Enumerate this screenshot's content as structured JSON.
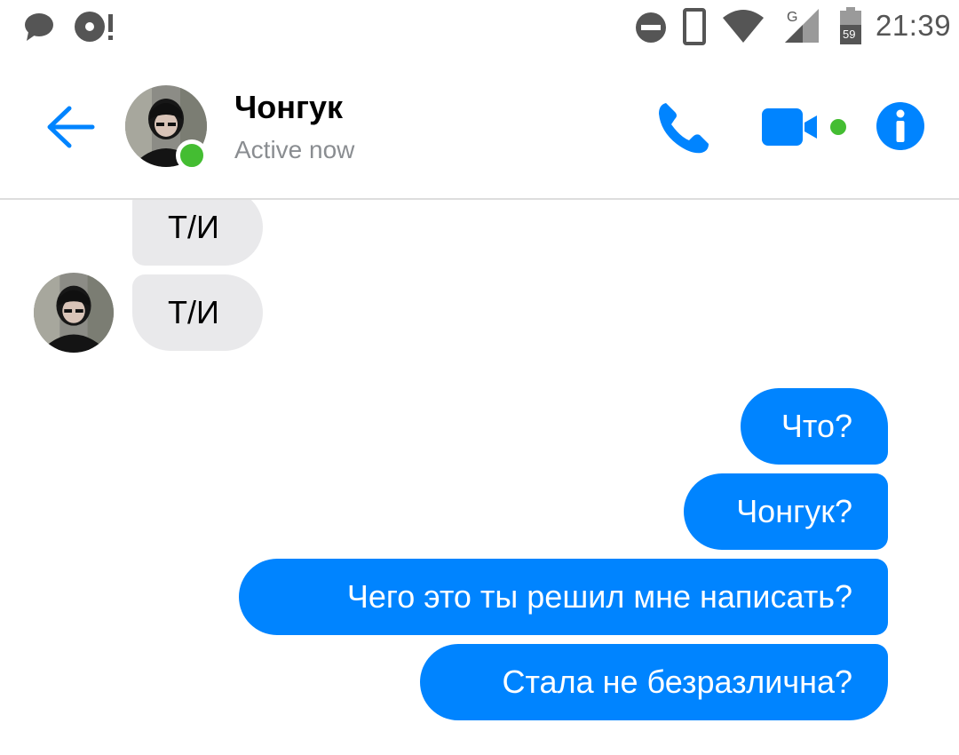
{
  "status_bar": {
    "time": "21:39",
    "battery_level": "59",
    "network_type": "G",
    "icons": [
      "messenger-bubble-icon",
      "music-disc-alert-icon",
      "do-not-disturb-icon",
      "phone-vibrate-icon",
      "wifi-icon",
      "cell-signal-icon",
      "battery-icon"
    ]
  },
  "header": {
    "contact_name": "Чонгук",
    "status": "Active now",
    "online_color": "#44bd32",
    "accent_color": "#0084ff"
  },
  "messages": [
    {
      "direction": "incoming",
      "text": "Т/И"
    },
    {
      "direction": "incoming",
      "text": "Т/И"
    },
    {
      "direction": "outgoing",
      "text": "Что?"
    },
    {
      "direction": "outgoing",
      "text": "Чонгук?"
    },
    {
      "direction": "outgoing",
      "text": "Чего это ты решил мне написать?"
    },
    {
      "direction": "outgoing",
      "text": "Стала не безразлична?"
    }
  ]
}
